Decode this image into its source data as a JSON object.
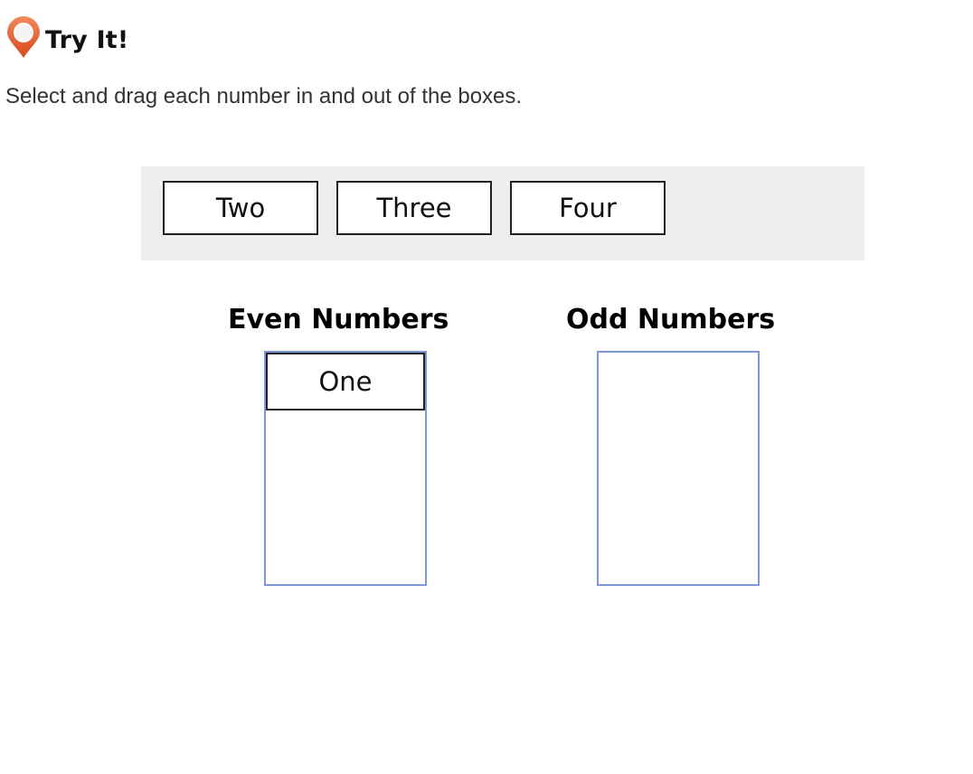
{
  "header": {
    "icon": "map-pin-icon",
    "title": "Try It!"
  },
  "instructions": "Select and drag each number in and out of the boxes.",
  "tray": {
    "items": [
      "Two",
      "Three",
      "Four"
    ]
  },
  "targets": [
    {
      "heading": "Even Numbers",
      "items": [
        "One"
      ]
    },
    {
      "heading": "Odd Numbers",
      "items": []
    }
  ],
  "colors": {
    "pin": "#e05a2b",
    "tray_background": "#eeeeee",
    "drop_box_border": "#7f97d6",
    "tile_border": "#222222"
  }
}
